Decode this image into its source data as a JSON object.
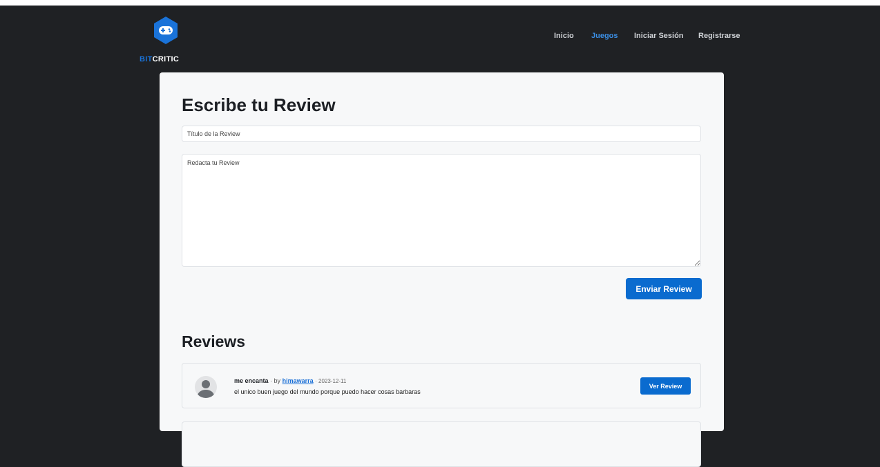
{
  "brand": {
    "part1": "BIT",
    "part2": "CRITIC"
  },
  "nav": [
    {
      "label": "Inicio",
      "active": false
    },
    {
      "label": "Juegos",
      "active": true
    },
    {
      "label": "Iniciar Sesión",
      "active": false
    },
    {
      "label": "Registrarse",
      "active": false
    }
  ],
  "form": {
    "heading": "Escribe tu Review",
    "title_placeholder": "Título de la Review",
    "body_placeholder": "Redacta tu Review",
    "submit_label": "Enviar Review"
  },
  "reviews_section": {
    "heading": "Reviews",
    "items": [
      {
        "title": "me encanta",
        "by_prefix": "· by",
        "user": "himawarra",
        "date": "· 2023-12-11",
        "text": "el unico buen juego del mundo porque puedo hacer cosas barbaras",
        "button_label": "Ver Review"
      }
    ]
  },
  "colors": {
    "accent": "#0a6bcf",
    "header_bg": "#1f2124",
    "card_bg": "#f7f8f9"
  }
}
